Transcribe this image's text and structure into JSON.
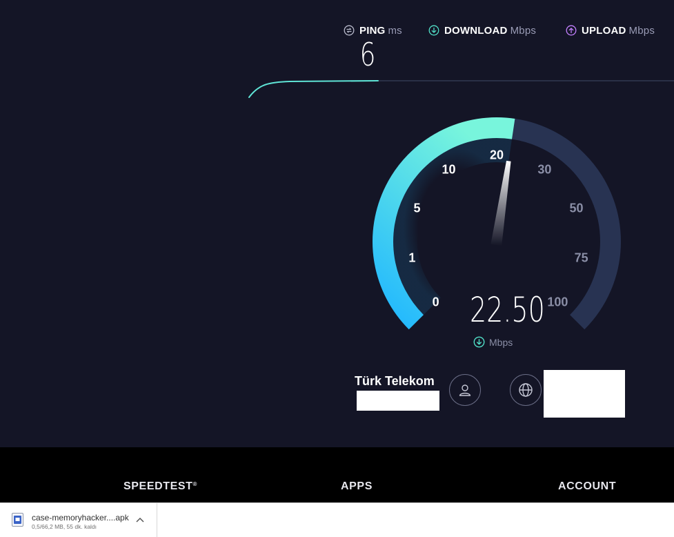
{
  "header": {
    "ping": {
      "label": "PING",
      "unit": "ms",
      "value": "6"
    },
    "download": {
      "label": "DOWNLOAD",
      "unit": "Mbps"
    },
    "upload": {
      "label": "UPLOAD",
      "unit": "Mbps"
    }
  },
  "gauge": {
    "ticks": [
      "0",
      "1",
      "5",
      "10",
      "20",
      "30",
      "50",
      "75",
      "100"
    ],
    "speed_value": "22.50",
    "speed_unit": "Mbps",
    "colors": {
      "start": "#1fb6ff",
      "end": "#78f5dc",
      "track": "#283352",
      "download_icon": "#51e0c8",
      "upload_icon": "#c481ff"
    }
  },
  "connection": {
    "isp_name": "Türk Telekom"
  },
  "footer": {
    "speedtest_label": "SPEEDTEST",
    "speedtest_mark": "®",
    "apps_label": "APPS",
    "account_label": "ACCOUNT"
  },
  "download_bar": {
    "file_name": "case-memoryhacker....apk",
    "status": "0,5/66,2 MB, 55 dk. kaldı"
  }
}
